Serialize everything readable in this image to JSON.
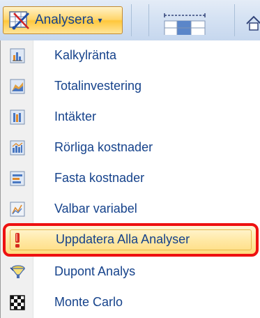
{
  "ribbon": {
    "analysera_label": "Analysera",
    "caret": "▾",
    "accent_color": "#ffc73a",
    "text_color": "#15428b"
  },
  "menu": {
    "items": [
      {
        "label": "Kalkylränta",
        "icon": "chart-kalkylranta-icon"
      },
      {
        "label": "Totalinvestering",
        "icon": "chart-totalinvestering-icon"
      },
      {
        "label": "Intäkter",
        "icon": "chart-intakter-icon"
      },
      {
        "label": "Rörliga kostnader",
        "icon": "chart-rorliga-kostnader-icon"
      },
      {
        "label": "Fasta kostnader",
        "icon": "chart-fasta-kostnader-icon"
      },
      {
        "label": "Valbar variabel",
        "icon": "chart-valbar-variabel-icon"
      },
      {
        "label": "Uppdatera Alla Analyser",
        "icon": "exclamation-icon",
        "highlighted": true
      },
      {
        "label": "Dupont Analys",
        "icon": "funnel-icon"
      },
      {
        "label": "Monte Carlo",
        "icon": "checkerboard-icon"
      }
    ],
    "highlight_border_color": "#ee1111"
  }
}
